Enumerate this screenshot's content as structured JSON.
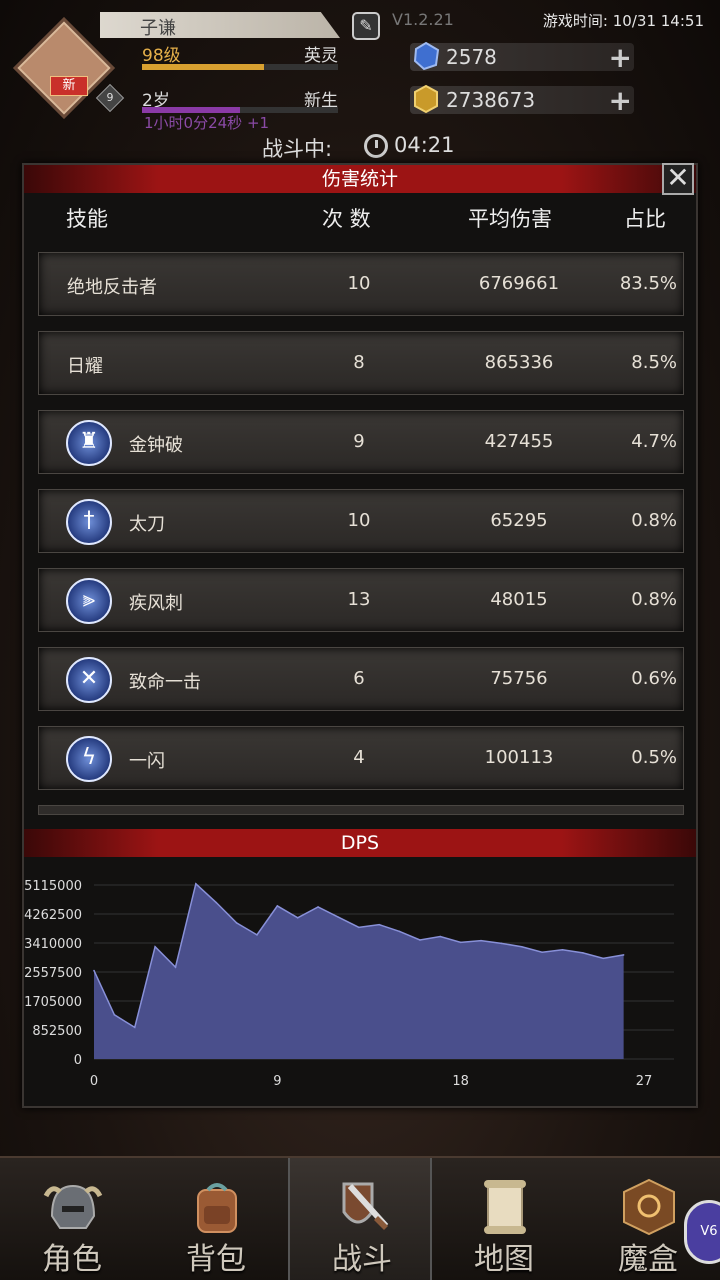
{
  "header": {
    "avatar_badge": "新",
    "avatar_level": "9",
    "player_name": "子谦",
    "version": "V1.2.21",
    "game_time_label": "游戏时间:",
    "game_time": "10/31 14:51",
    "level_text": "98级",
    "rank_text": "英灵",
    "level_progress": 0.62,
    "age_text": "2岁",
    "age_state": "新生",
    "age_progress": 0.5,
    "age_timer": "1小时0分24秒 +1",
    "gems": "2578",
    "gold": "2738673",
    "battle_label": "战斗中:",
    "battle_time": "04:21"
  },
  "damage_panel": {
    "title": "伤害统计",
    "columns": [
      "技能",
      "次 数",
      "平均伤害",
      "占比"
    ],
    "rows": [
      {
        "skill": "绝地反击者",
        "icon": "",
        "count": "10",
        "avg": "6769661",
        "pct": "83.5%"
      },
      {
        "skill": "日耀",
        "icon": "",
        "count": "8",
        "avg": "865336",
        "pct": "8.5%"
      },
      {
        "skill": "金钟破",
        "icon": "warrior-shield-icon",
        "count": "9",
        "avg": "427455",
        "pct": "4.7%"
      },
      {
        "skill": "太刀",
        "icon": "sword-icon",
        "count": "10",
        "avg": "65295",
        "pct": "0.8%"
      },
      {
        "skill": "疾风刺",
        "icon": "triple-blade-icon",
        "count": "13",
        "avg": "48015",
        "pct": "0.8%"
      },
      {
        "skill": "致命一击",
        "icon": "crossed-blades-icon",
        "count": "6",
        "avg": "75756",
        "pct": "0.6%"
      },
      {
        "skill": "一闪",
        "icon": "flash-slash-icon",
        "count": "4",
        "avg": "100113",
        "pct": "0.5%"
      }
    ]
  },
  "dps_title": "DPS",
  "chart_data": {
    "type": "area",
    "title": "DPS",
    "xlabel": "",
    "ylabel": "",
    "x_ticks": [
      "0",
      "9",
      "18",
      "27"
    ],
    "y_ticks": [
      "0",
      "852500",
      "1705000",
      "2557500",
      "3410000",
      "4262500",
      "5115000"
    ],
    "ylim": [
      0,
      5115000
    ],
    "xlim": [
      0,
      27
    ],
    "x": [
      0,
      1,
      2,
      3,
      4,
      5,
      6,
      7,
      8,
      9,
      10,
      11,
      12,
      13,
      14,
      15,
      16,
      17,
      18,
      19,
      20,
      21,
      22,
      23,
      24,
      25,
      26
    ],
    "values": [
      2600000,
      1300000,
      930000,
      3300000,
      2700000,
      5150000,
      4600000,
      4000000,
      3650000,
      4500000,
      4150000,
      4470000,
      4170000,
      3870000,
      3950000,
      3750000,
      3500000,
      3600000,
      3430000,
      3480000,
      3400000,
      3300000,
      3140000,
      3210000,
      3120000,
      2960000,
      3060000
    ],
    "fill_color": "#4a4f8c",
    "line_color": "#8890d8",
    "grid": true
  },
  "nav": {
    "items": [
      {
        "label": "角色",
        "icon": "helmet-icon"
      },
      {
        "label": "背包",
        "icon": "backpack-icon"
      },
      {
        "label": "战斗",
        "icon": "sword-shield-icon"
      },
      {
        "label": "地图",
        "icon": "scroll-map-icon"
      },
      {
        "label": "魔盒",
        "icon": "magic-box-icon"
      }
    ],
    "vip_badge": "V6"
  }
}
